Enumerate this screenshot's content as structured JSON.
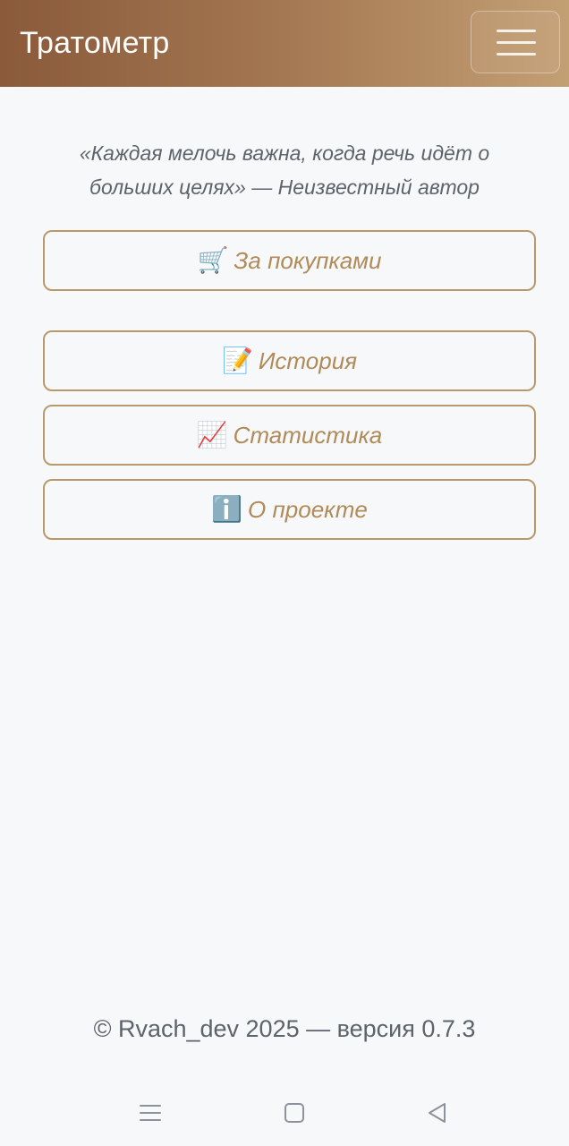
{
  "navbar": {
    "brand": "Тратометр",
    "menu_icon": "hamburger-icon"
  },
  "quote": "«Каждая мелочь важна, когда речь идёт о больших целях» — Неизвестный автор",
  "menu": {
    "shopping": {
      "emoji": "🛒",
      "label": "За покупками"
    },
    "history": {
      "emoji": "📝",
      "label": "История"
    },
    "stats": {
      "emoji": "📈",
      "label": "Статистика"
    },
    "about": {
      "emoji": "ℹ️",
      "label": "О проекте"
    }
  },
  "footer": "© Rvach_dev 2025 — версия 0.7.3",
  "system_nav": {
    "recents_icon": "menu-lines-icon",
    "home_icon": "square-icon",
    "back_icon": "triangle-back-icon"
  },
  "colors": {
    "accent": "#b08a58",
    "border": "#b89a6a",
    "navbar_start": "#8a5a3a",
    "navbar_end": "#c39f74",
    "text_muted": "#5d636b",
    "background": "#f7f8fa"
  }
}
